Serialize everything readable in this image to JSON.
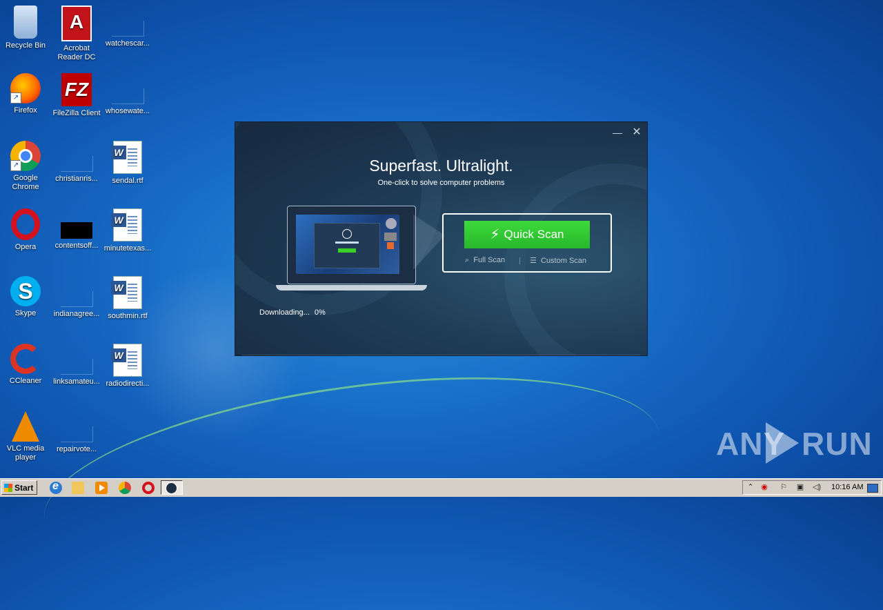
{
  "desktop": {
    "icons": [
      {
        "label": "Recycle Bin"
      },
      {
        "label": "Acrobat Reader DC"
      },
      {
        "label": "watchescar..."
      },
      {
        "label": "Firefox"
      },
      {
        "label": "FileZilla Client"
      },
      {
        "label": "whosewate..."
      },
      {
        "label": "Google Chrome"
      },
      {
        "label": "christianris..."
      },
      {
        "label": "sendal.rtf"
      },
      {
        "label": "Opera"
      },
      {
        "label": "contentsoff..."
      },
      {
        "label": "minutetexas..."
      },
      {
        "label": "Skype"
      },
      {
        "label": "indianagree..."
      },
      {
        "label": "southmin.rtf"
      },
      {
        "label": "CCleaner"
      },
      {
        "label": "linksamateu..."
      },
      {
        "label": "radiodirecti..."
      },
      {
        "label": "VLC media player"
      },
      {
        "label": "repairvote..."
      }
    ]
  },
  "installer": {
    "title": "Superfast. Ultralight.",
    "subtitle": "One-click to solve computer problems",
    "minimize_icon": "minimize-icon",
    "close_icon": "close-icon",
    "quick_scan_label": "Quick Scan",
    "full_scan_label": "Full Scan",
    "custom_scan_label": "Custom Scan",
    "download_status": "Downloading...",
    "download_percent": "0%",
    "accent_color": "#2ec42e"
  },
  "watermark": {
    "left": "ANY",
    "right": "RUN"
  },
  "taskbar": {
    "start_label": "Start",
    "clock": "10:16 AM"
  }
}
